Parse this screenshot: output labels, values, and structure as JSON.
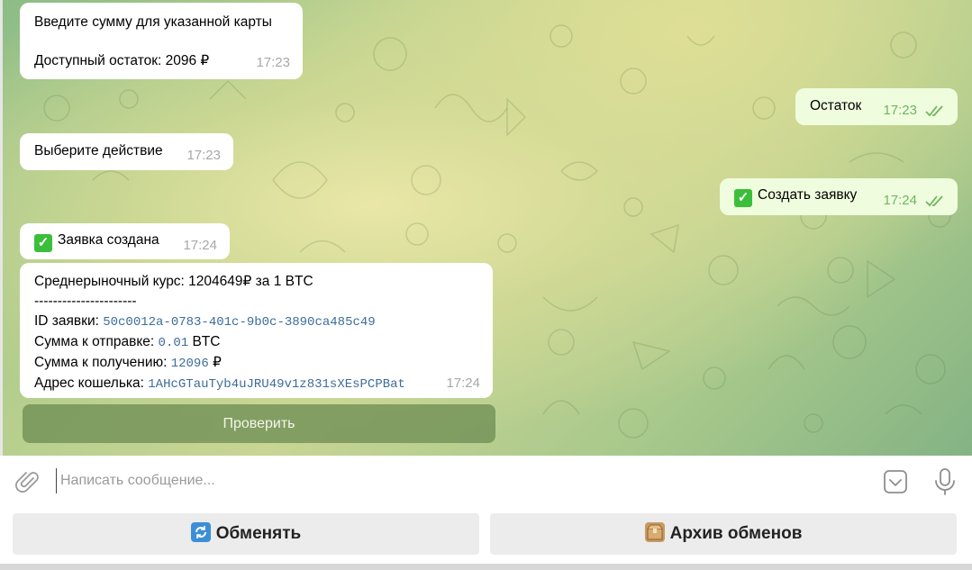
{
  "messages": {
    "m1": {
      "line1": "Введите сумму для указанной карты",
      "line2": "Доступный остаток: 2096 ₽",
      "time": "17:23"
    },
    "m2": {
      "text": "Остаток",
      "time": "17:23"
    },
    "m3": {
      "text": "Выберите действие",
      "time": "17:23"
    },
    "m4": {
      "text": "Создать заявку",
      "time": "17:24"
    },
    "m5": {
      "text": "Заявка создана",
      "time": "17:24"
    },
    "m6": {
      "rate": "Среднерыночный курс: 1204649₽ за 1 BTC",
      "separator": "----------------------",
      "id_label": "ID заявки: ",
      "id_value": "50c0012a-0783-401c-9b0c-3890ca485c49",
      "send_label": "Сумма к отправке: ",
      "send_value": "0.01",
      "send_unit": " BTC",
      "receive_label": "Сумма к получению: ",
      "receive_value": "12096",
      "receive_unit": " ₽",
      "wallet_label": "Адрес кошелька: ",
      "wallet_value": "1AHcGTauTyb4uJRU49v1z831sXEsPCPBat",
      "time": "17:24"
    }
  },
  "inline_button": {
    "label": "Проверить"
  },
  "composer": {
    "placeholder": "Написать сообщение..."
  },
  "keyboard": {
    "exchange_label": "Обменять",
    "archive_label": "Архив обменов"
  },
  "colors": {
    "outgoing_bubble": "#effdde",
    "incoming_bubble": "#ffffff",
    "check_emoji": "#3bbf3b",
    "mono_text": "#3d6c9a"
  },
  "icons": [
    "paperclip-icon",
    "sticker-icon",
    "microphone-icon",
    "double-check-icon",
    "check-mark-emoji",
    "refresh-emoji",
    "package-emoji"
  ]
}
